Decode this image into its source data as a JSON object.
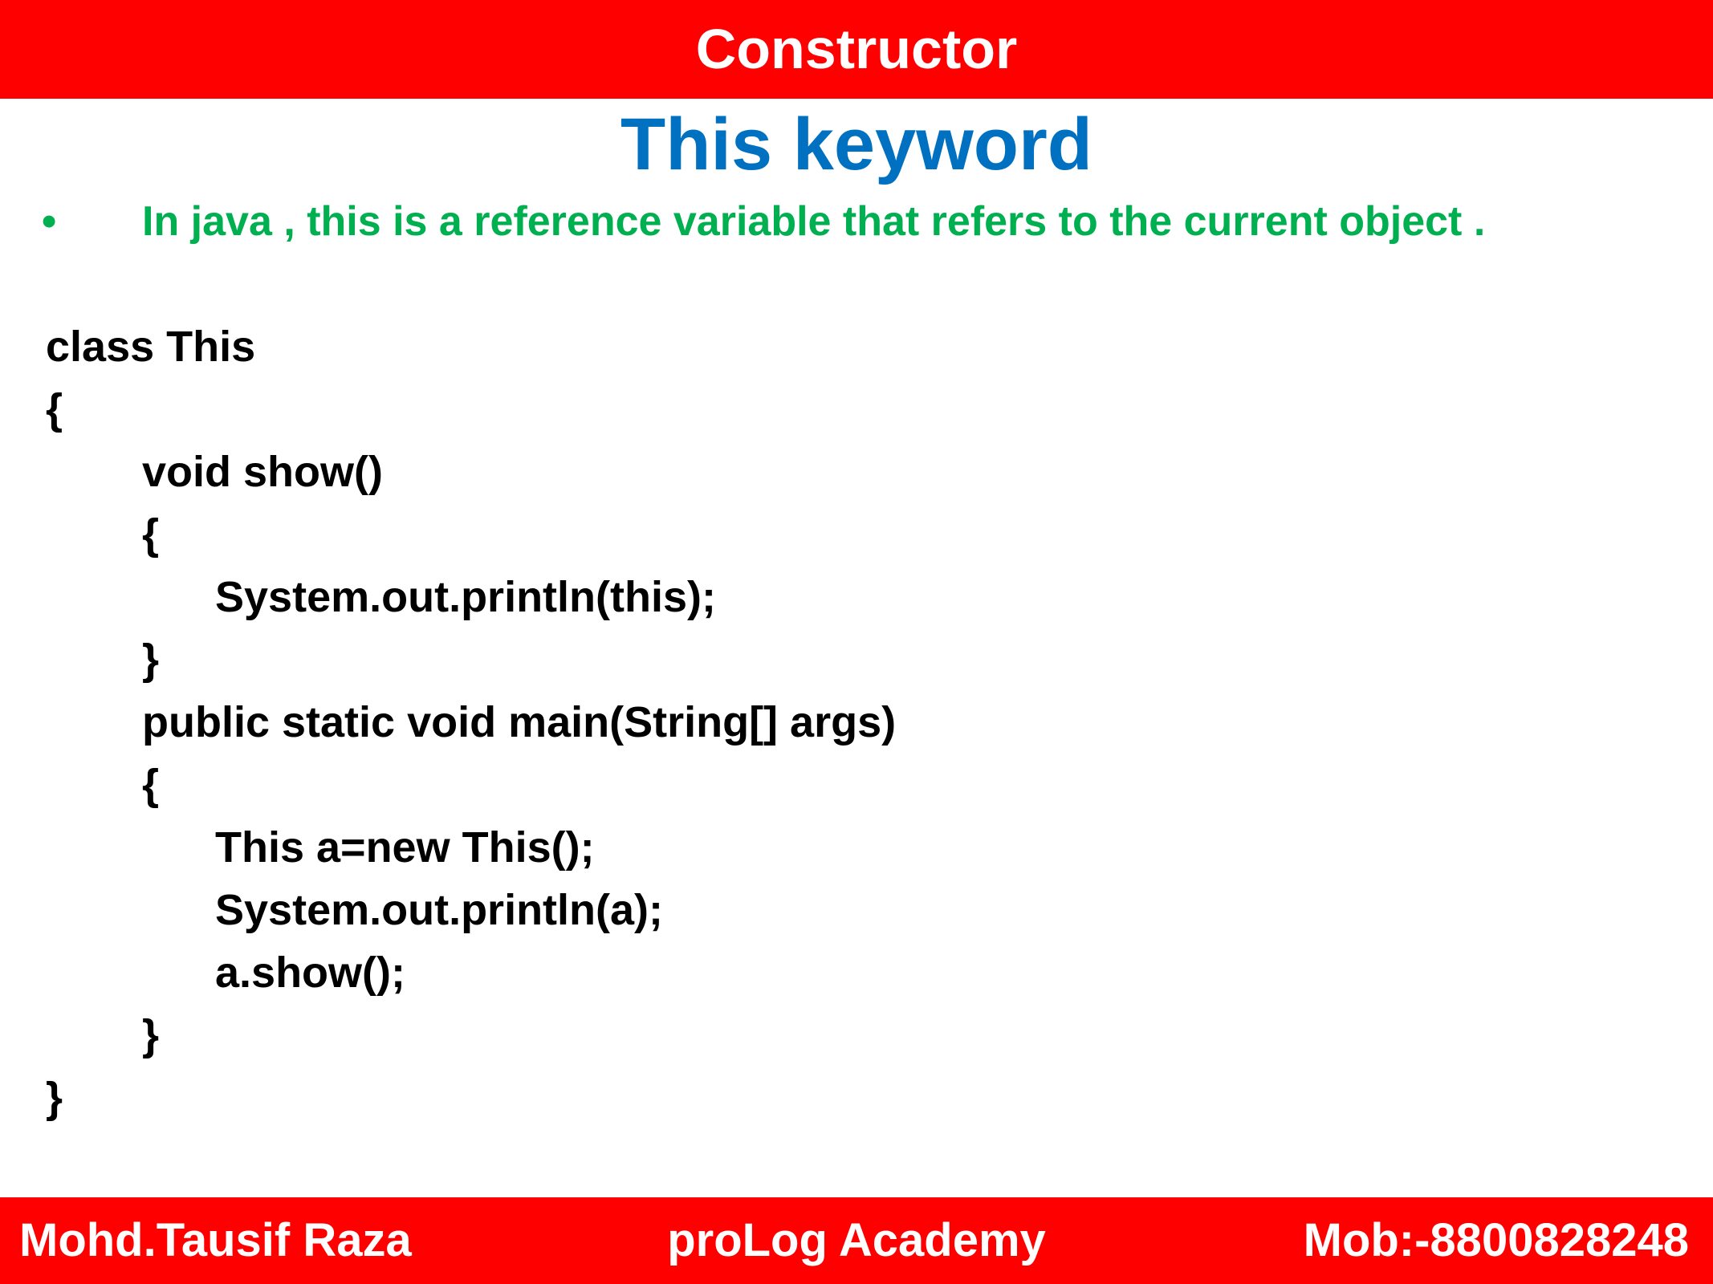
{
  "header": {
    "title": "Constructor",
    "bar_color": "#ff0000"
  },
  "slide": {
    "title": "This keyword",
    "title_color": "#0070c0",
    "bullet_symbol": "•",
    "bullet_text": "In java , this is a reference variable that refers to the current object .",
    "bullet_color": "#00b050"
  },
  "code": {
    "lines": [
      "class This",
      "{",
      "void show()",
      "{",
      "System.out.println(this);",
      "}",
      "public static void main(String[] args)",
      "{",
      "This a=new This();",
      "System.out.println(a);",
      "a.show();",
      "}",
      "}"
    ]
  },
  "footer": {
    "author": "Mohd.Tausif Raza",
    "academy": "proLog Academy",
    "mobile": "Mob:-8800828248"
  }
}
